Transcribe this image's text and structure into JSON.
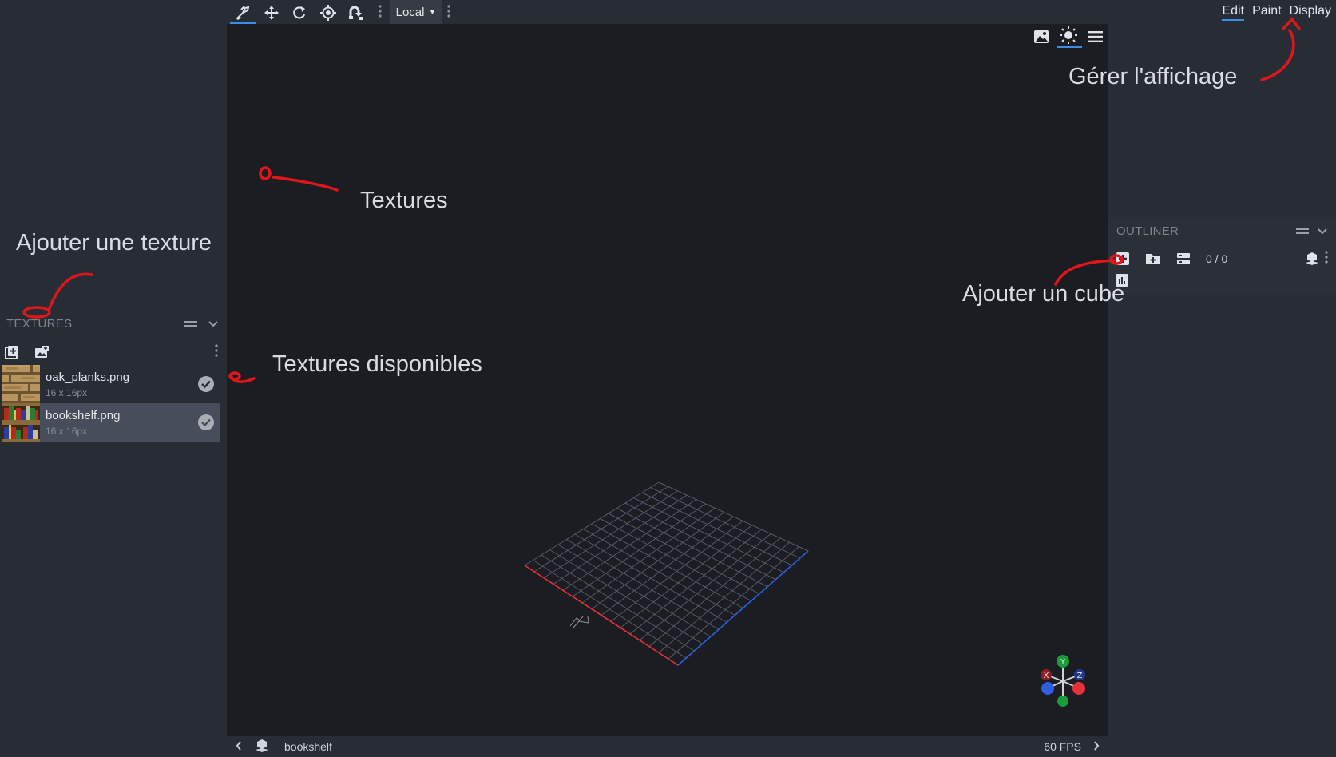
{
  "toolbar": {
    "tools": [
      {
        "icon": "pivot-brush-icon",
        "active": true
      },
      {
        "icon": "move-icon",
        "active": false
      },
      {
        "icon": "rotate-icon",
        "active": false
      },
      {
        "icon": "pivot-icon",
        "active": false
      },
      {
        "icon": "vertex-snap-icon",
        "active": false
      }
    ],
    "space_select": "Local"
  },
  "modes": {
    "tabs": [
      {
        "label": "Edit",
        "active": true
      },
      {
        "label": "Paint",
        "active": false
      },
      {
        "label": "Display",
        "active": false
      }
    ]
  },
  "textures_panel": {
    "title": "TEXTURES",
    "items": [
      {
        "name": "oak_planks.png",
        "size": "16 x 16px",
        "selected": false
      },
      {
        "name": "bookshelf.png",
        "size": "16 x 16px",
        "selected": true
      }
    ]
  },
  "outliner": {
    "title": "OUTLINER",
    "counter": "0 / 0"
  },
  "status_bar": {
    "model_name": "bookshelf",
    "fps": "60 FPS"
  },
  "gizmo": {
    "x_label": "X",
    "y_label": "Y",
    "z_label": "Z"
  },
  "annotations": {
    "display": "Gérer l'affichage",
    "textures": "Textures",
    "add_texture": "Ajouter une texture",
    "available": "Textures disponibles",
    "add_cube": "Ajouter un cube"
  },
  "colors": {
    "accent": "#3b8ee8",
    "annotation_red": "#e0161a",
    "axis_x": "#e8303a",
    "axis_z": "#2f5fe0",
    "axis_y": "#1a9c3a"
  }
}
